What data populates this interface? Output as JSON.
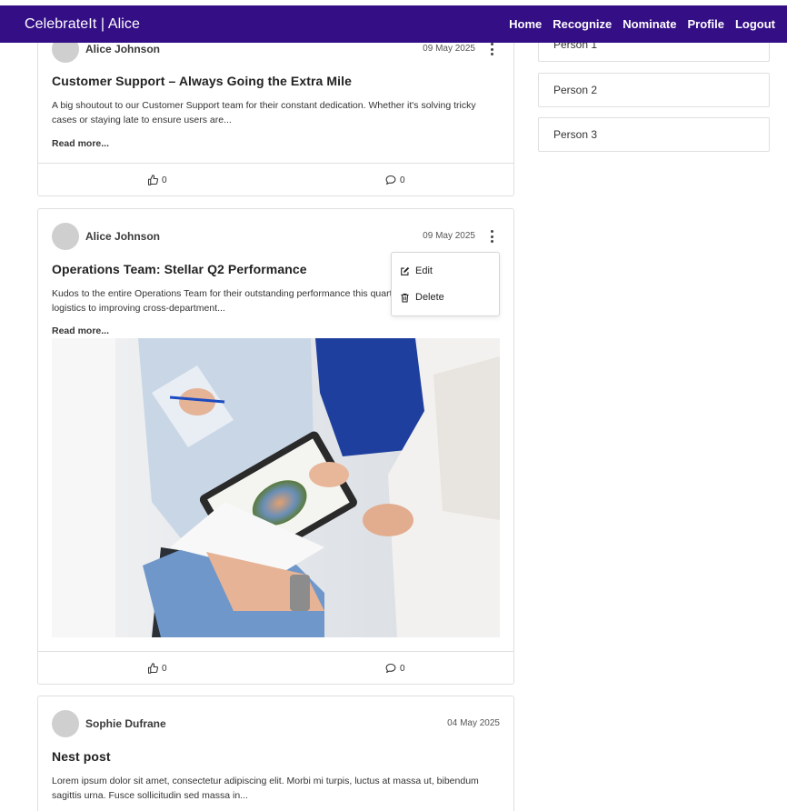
{
  "navbar": {
    "brand": "CelebrateIt | Alice",
    "links": [
      "Home",
      "Recognize",
      "Nominate",
      "Profile",
      "Logout"
    ]
  },
  "posts": [
    {
      "author": "Alice Johnson",
      "date": "09 May 2025",
      "title": "Customer Support – Always Going the Extra Mile",
      "excerpt": "A big shoutout to our Customer Support team for their constant dedication. Whether it's solving tricky cases or staying late to ensure users are...",
      "read_more": "Read more...",
      "likes": "0",
      "comments": "0"
    },
    {
      "author": "Alice Johnson",
      "date": "09 May 2025",
      "title": "Operations Team: Stellar Q2 Performance",
      "excerpt": "Kudos to the entire Operations Team for their outstanding performance this quarter. From streamlining logistics to improving cross-department...",
      "read_more": "Read more...",
      "likes": "0",
      "comments": "0"
    },
    {
      "author": "Sophie Dufrane",
      "date": "04 May 2025",
      "title": "Nest post",
      "excerpt": "Lorem ipsum dolor sit amet, consectetur adipiscing elit. Morbi mi turpis, luctus at massa ut, bibendum sagittis urna. Fusce sollicitudin sed massa in..."
    }
  ],
  "post_menu": {
    "edit": "Edit",
    "delete": "Delete"
  },
  "sidebar": {
    "people": [
      "Person 1",
      "Person 2",
      "Person 3"
    ]
  },
  "colors": {
    "navbar": "#330e85",
    "avatar": "#cfcfcf",
    "border": "#dfdfdf"
  },
  "icons": [
    "thumbs-up-icon",
    "comment-icon",
    "kebab-menu-icon",
    "edit-icon",
    "trash-icon"
  ]
}
